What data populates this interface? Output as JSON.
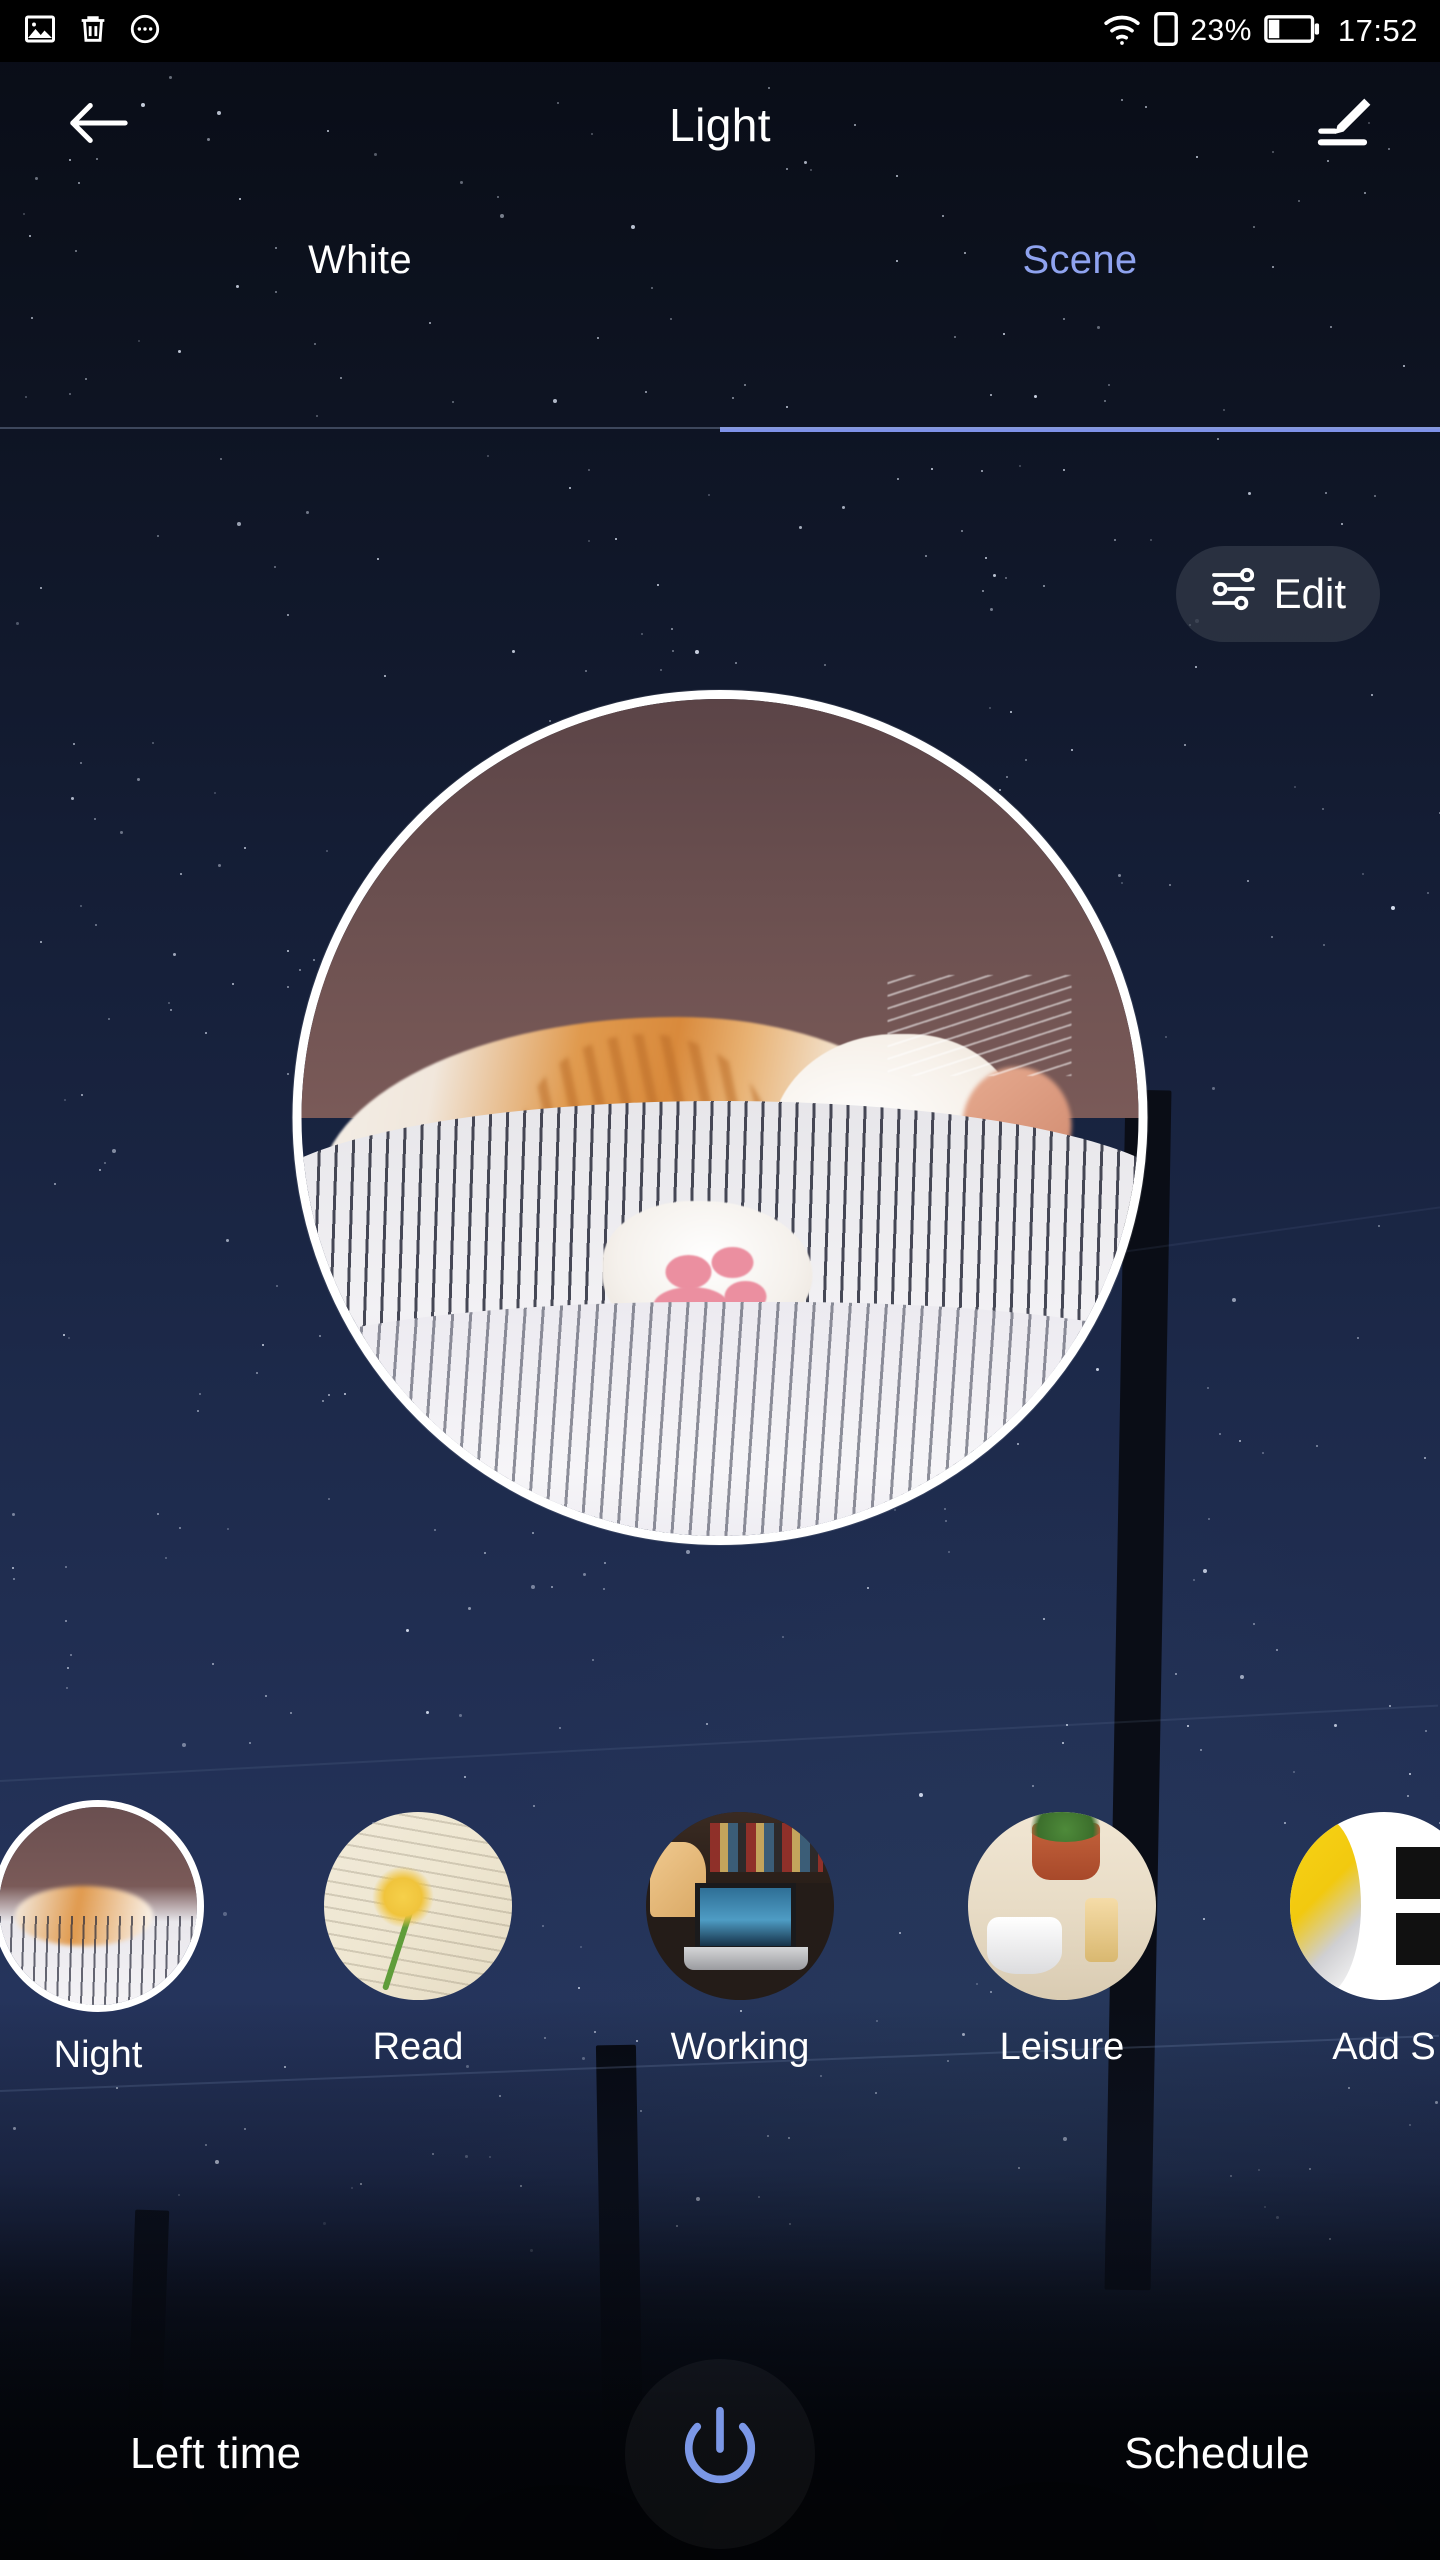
{
  "status_bar": {
    "left_icons": [
      "image-icon",
      "trash-icon",
      "more-circle-icon"
    ],
    "wifi_icon": "wifi-icon",
    "sim_icon": "sim-card-icon",
    "battery_percent": "23%",
    "battery_icon": "battery-icon",
    "time": "17:52"
  },
  "app_bar": {
    "back_icon": "back-arrow-icon",
    "title": "Light",
    "rename_icon": "pencil-edit-icon"
  },
  "tabs": [
    {
      "label": "White",
      "active": false
    },
    {
      "label": "Scene",
      "active": true
    }
  ],
  "edit_button": {
    "label": "Edit",
    "icon": "sliders-tune-icon"
  },
  "preview": {
    "alt": "sleeping orange and white cat on striped bedding",
    "scene_name": "Night"
  },
  "scenes": [
    {
      "label": "Night",
      "selected": true,
      "thumb": "sleeping-cat-photo"
    },
    {
      "label": "Read",
      "selected": false,
      "thumb": "flower-on-book-photo"
    },
    {
      "label": "Working",
      "selected": false,
      "thumb": "desk-with-laptop-photo"
    },
    {
      "label": "Leisure",
      "selected": false,
      "thumb": "coffee-and-plant-photo"
    },
    {
      "label": "Add S",
      "selected": false,
      "thumb": "add-scene-icon"
    }
  ],
  "bottom_bar": {
    "left_label": "Left time",
    "power_icon": "power-icon",
    "right_label": "Schedule"
  },
  "colors": {
    "accent_blue": "#8fa3ef",
    "tab_underline": "#7f92e8",
    "power_blue": "#7b97e6",
    "text_white": "#ffffff",
    "status_bar_bg": "#000000",
    "pill_bg": "rgba(48,55,70,0.80)"
  }
}
